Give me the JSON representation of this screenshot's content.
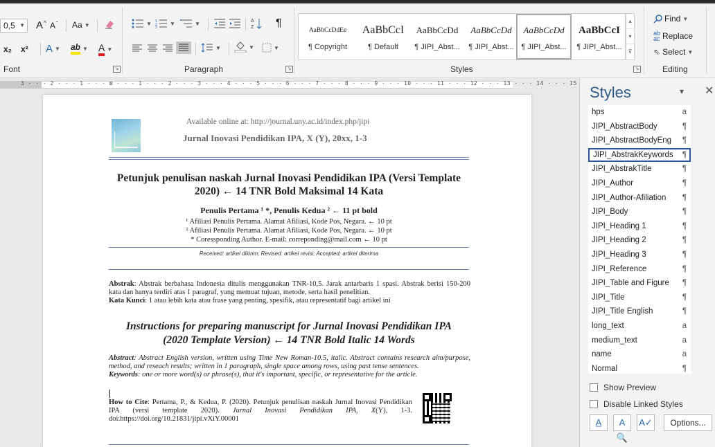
{
  "ribbon": {
    "font": {
      "size": "0,5",
      "grow": "A",
      "shrink": "A",
      "change_case": "Aa",
      "clear_format": "",
      "subscript": "x₂",
      "superscript": "x²",
      "text_effects": "A",
      "highlight": "ab",
      "font_color": "A",
      "label": "Font"
    },
    "paragraph": {
      "label": "Paragraph"
    },
    "styles": {
      "label": "Styles",
      "gallery": [
        {
          "sample": "AaBbCcDdEe",
          "name": "¶ Copyright"
        },
        {
          "sample": "AaBbCcI",
          "name": "¶ Default"
        },
        {
          "sample": "AaBbCcDd",
          "name": "¶ JIPI_Abst..."
        },
        {
          "sample": "AaBbCcDd",
          "name": "¶ JIPI_Abst..."
        },
        {
          "sample": "AaBbCcDd",
          "name": "¶ JIPI_Abst..."
        },
        {
          "sample": "AaBbCcI",
          "name": "¶ JIPI_Abst..."
        }
      ]
    },
    "editing": {
      "find": "Find",
      "replace": "Replace",
      "select": "Select",
      "label": "Editing"
    }
  },
  "ruler": {
    "text": "3 · · · 2 · · · 1 · · · ⊠ · · · 1 · · · 2 · · · 3 · · · 4 · · · 5 · · · 6 · · · 7 · · · 8 · · · 9 · · · 10 · · · 11 · · · 12 · · · 13 · · · 14 · · · 15 · · · △ · · 17 · · ·"
  },
  "document": {
    "header_url": "Available online at: http://journal.uny.ac.id/index.php/jipi",
    "header_journal": "Jurnal Inovasi Pendidikan IPA, X (Y), 20xx, 1-3",
    "title_line1": "Petunjuk penulisan naskah Jurnal Inovasi Pendidikan IPA (Versi Template",
    "title_line2": "2020) ← 14 TNR Bold Maksimal 14 Kata",
    "authors": "Penulis Pertama ¹ *, Penulis Kedua ² ← 11 pt bold",
    "affil1": "¹ Afiliasi Penulis Pertama. Alamat Afiliasi, Kode Pos, Negara. ← 10 pt",
    "affil2": "² Afiliasi Penulis Pertama. Alamat Afiliasi, Kode Pos, Negara. ← 10 pt",
    "corresponding": "* Coressponding Author. E-mail: correponding@mail.com ← 10 pt",
    "received": "Received: artikel dikirim; Revised: artikel revisi; Accepted: artikel diterima",
    "abstrak_label": "Abstrak",
    "abstrak_text": ": Abstrak berbahasa Indonesia ditulis menggunakan TNR-10,5. Jarak antarbaris 1 spasi. Abstrak berisi 150-200 kata dan hanya terdiri atas 1 paragraf, yang memuat tujuan, metode, serta hasil penelitian.",
    "kata_kunci_label": "Kata Kunci",
    "kata_kunci_text": ": 1 atau lebih kata atau frase yang penting, spesifik, atau representatif bagi artikel ini",
    "title_en_line1": "Instructions for preparing manuscript for Jurnal Inovasi Pendidikan IPA",
    "title_en_line2": "(2020 Template Version) ← 14 TNR Bold Italic 14 Words",
    "abstract_label": "Abstract",
    "abstract_text": ": Abstract English version, written using Time New Roman-10.5, italic. Abstract contains research aim/purpose, method, and reseach results; written in 1 paragraph, single space among rows, using past tense sentences.",
    "keywords_label": "Keywords",
    "keywords_text": ": one or more word(s) or phrase(s), that it's important, specific, or representative for the article.",
    "cite_label": "How to Cite",
    "cite_text": ": Pertama, P., & Kedua, P. (2020). Petunjuk penulisan naskah Jurnal Inovasi Pendidikan IPA (versi template 2020).",
    "cite_journal": "Jurnal Inovasi Pendidikan IPA, X",
    "cite_tail": "(Y), 1-3. doi:https://doi.org/10.21831/jipi.vXiY.00001"
  },
  "styles_pane": {
    "title": "Styles",
    "menu": "▾",
    "close": "✕",
    "items": [
      {
        "name": "hps",
        "sym": "a"
      },
      {
        "name": "JIPI_AbstractBody",
        "sym": "¶"
      },
      {
        "name": "JIPI_AbstractBodyEng",
        "sym": "¶"
      },
      {
        "name": "JIPI_AbstrakKeywords",
        "sym": "¶"
      },
      {
        "name": "JIPI_AbstrakTitle",
        "sym": "¶"
      },
      {
        "name": "JIPI_Author",
        "sym": "¶"
      },
      {
        "name": "JIPI_Author-Afiliation",
        "sym": "¶"
      },
      {
        "name": "JIPI_Body",
        "sym": "¶"
      },
      {
        "name": "JIPI_Heading 1",
        "sym": "¶"
      },
      {
        "name": "JIPI_Heading 2",
        "sym": "¶"
      },
      {
        "name": "JIPI_Heading 3",
        "sym": "¶"
      },
      {
        "name": "JIPI_Reference",
        "sym": "¶"
      },
      {
        "name": "JIPI_Table and Figure",
        "sym": "¶"
      },
      {
        "name": "JIPI_Title",
        "sym": "¶"
      },
      {
        "name": "JIPI_Title English",
        "sym": "¶"
      },
      {
        "name": "long_text",
        "sym": "a"
      },
      {
        "name": "medium_text",
        "sym": "a"
      },
      {
        "name": "name",
        "sym": "a"
      },
      {
        "name": "Normal",
        "sym": "¶"
      }
    ],
    "show_preview": "Show Preview",
    "disable_linked": "Disable Linked Styles",
    "options": "Options..."
  }
}
